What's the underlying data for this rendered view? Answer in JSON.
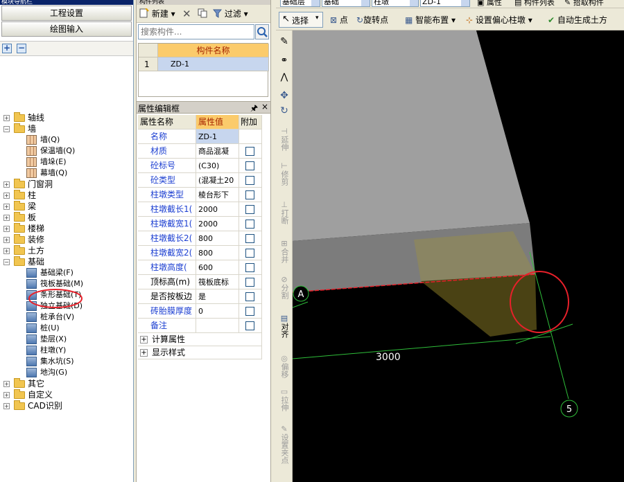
{
  "left_panel": {
    "title": "模块导航栏",
    "btn_project_settings": "工程设置",
    "btn_drawing_input": "绘图输入",
    "add": "+",
    "remove": "−",
    "tree": [
      {
        "label": "轴线",
        "level": 0,
        "expand": "+"
      },
      {
        "label": "墙",
        "level": 0,
        "expand": "−"
      },
      {
        "label": "墙(Q)",
        "level": 1
      },
      {
        "label": "保温墙(Q)",
        "level": 1
      },
      {
        "label": "墙垛(E)",
        "level": 1
      },
      {
        "label": "幕墙(Q)",
        "level": 1
      },
      {
        "label": "门窗洞",
        "level": 0,
        "expand": "+"
      },
      {
        "label": "柱",
        "level": 0,
        "expand": "+"
      },
      {
        "label": "梁",
        "level": 0,
        "expand": "+"
      },
      {
        "label": "板",
        "level": 0,
        "expand": "+"
      },
      {
        "label": "楼梯",
        "level": 0,
        "expand": "+"
      },
      {
        "label": "装修",
        "level": 0,
        "expand": "+"
      },
      {
        "label": "土方",
        "level": 0,
        "expand": "+"
      },
      {
        "label": "基础",
        "level": 0,
        "expand": "−"
      },
      {
        "label": "基础梁(F)",
        "level": 1
      },
      {
        "label": "筏板基础(M)",
        "level": 1
      },
      {
        "label": "条形基础(T)",
        "level": 1
      },
      {
        "label": "独立基础(D)",
        "level": 1
      },
      {
        "label": "桩承台(V)",
        "level": 1
      },
      {
        "label": "桩(U)",
        "level": 1
      },
      {
        "label": "垫层(X)",
        "level": 1
      },
      {
        "label": "柱墩(Y)",
        "level": 1
      },
      {
        "label": "集水坑(S)",
        "level": 1
      },
      {
        "label": "地沟(G)",
        "level": 1
      },
      {
        "label": "其它",
        "level": 0,
        "expand": "+"
      },
      {
        "label": "自定义",
        "level": 0,
        "expand": "+"
      },
      {
        "label": "CAD识别",
        "level": 0,
        "expand": "+"
      }
    ]
  },
  "component_list": {
    "title": "构件列表",
    "new_label": "新建",
    "filter_label": "过滤",
    "search_placeholder": "搜索构件...",
    "col_name": "构件名称",
    "rows": [
      {
        "index": "1",
        "name": "ZD-1"
      }
    ]
  },
  "property_editor": {
    "title": "属性编辑框",
    "pin": "ᵖ",
    "close": "×",
    "col_name": "属性名称",
    "col_value": "属性值",
    "col_extra": "附加",
    "rows": [
      {
        "name": "名称",
        "value": "ZD-1",
        "blue": true,
        "check": false
      },
      {
        "name": "材质",
        "value": "商品混凝",
        "blue": true,
        "check": true
      },
      {
        "name": "砼标号",
        "value": "(C30)",
        "blue": true,
        "check": true
      },
      {
        "name": "砼类型",
        "value": "(混凝土20",
        "blue": true,
        "check": true
      },
      {
        "name": "柱墩类型",
        "value": "棱台形下",
        "blue": true,
        "check": true
      },
      {
        "name": "柱墩截长1(",
        "value": "2000",
        "blue": true,
        "check": true
      },
      {
        "name": "柱墩截宽1(",
        "value": "2000",
        "blue": true,
        "check": true
      },
      {
        "name": "柱墩截长2(",
        "value": "800",
        "blue": true,
        "check": true
      },
      {
        "name": "柱墩截宽2(",
        "value": "800",
        "blue": true,
        "check": true
      },
      {
        "name": "柱墩高度(",
        "value": "600",
        "blue": true,
        "check": true
      },
      {
        "name": "顶标高(m)",
        "value": "筏板底标",
        "blue": false,
        "check": true
      },
      {
        "name": "是否按板边",
        "value": "是",
        "blue": false,
        "check": true
      },
      {
        "name": "砖胎膜厚度",
        "value": "0",
        "blue": true,
        "check": true
      },
      {
        "name": "备注",
        "value": "",
        "blue": true,
        "check": true
      }
    ],
    "groups": [
      {
        "label": "计算属性",
        "expand": "+"
      },
      {
        "label": "显示样式",
        "expand": "+"
      }
    ]
  },
  "top_toolbar": {
    "floor": "基础层",
    "category": "基础",
    "type": "柱墩",
    "component": "ZD-1",
    "properties": "属性",
    "component_list": "构件列表",
    "pick": "拾取构件"
  },
  "draw_toolbar": {
    "select": "选择",
    "point": "点",
    "rotate_point": "旋转点",
    "smart_layout": "智能布置",
    "eccentric": "设置偏心柱墩",
    "auto_earthwork": "自动生成土方"
  },
  "side_tools": {
    "extend": "延伸",
    "trim": "修剪",
    "break": "打断",
    "merge": "合并",
    "split": "分割",
    "align": "对齐",
    "offset": "偏移",
    "stretch": "拉伸",
    "set_grip": "设置夹点"
  },
  "canvas": {
    "dimension_label": "3000",
    "axis_label_5": "5",
    "axis_label_a": "A"
  },
  "colors": {
    "accent_blue": "#1c3fd1",
    "selection": "#c7d6ee",
    "header_orange": "#fbcb6b",
    "highlight_red": "#e8202a",
    "axis_green": "#2fbf3a"
  }
}
